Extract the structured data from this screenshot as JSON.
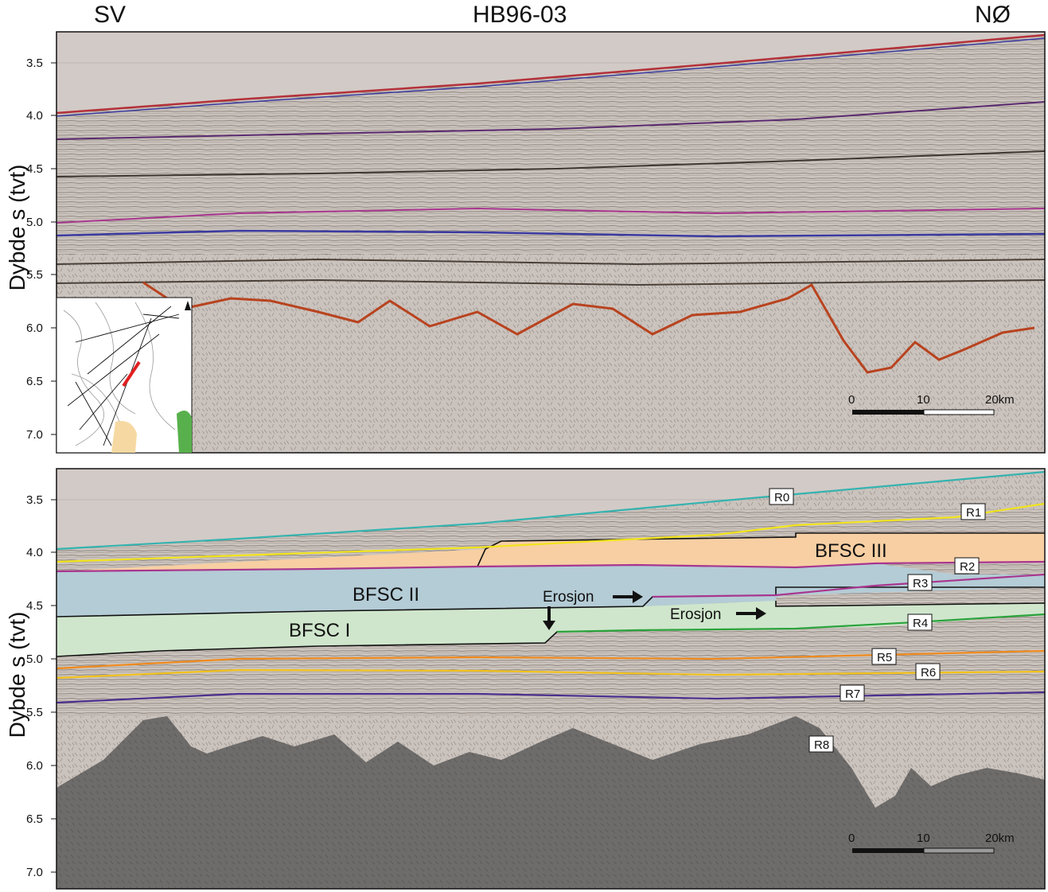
{
  "header": {
    "left": "SV",
    "title": "HB96-03",
    "right": "NØ"
  },
  "axis": {
    "label": "Dybde s (tvt)",
    "ticks": [
      "3.5",
      "4.0",
      "4.5",
      "5.0",
      "5.5",
      "6.0",
      "6.5",
      "7.0"
    ]
  },
  "scale_bar": {
    "labels": [
      "0",
      "10",
      "20km"
    ]
  },
  "units": {
    "bfsc3": "BFSC III",
    "bfsc2": "BFSC II",
    "bfsc1": "BFSC I"
  },
  "annotations": {
    "erosion_1": "Erosjon",
    "erosion_2": "Erosjon"
  },
  "reflectors": [
    "R0",
    "R1",
    "R2",
    "R3",
    "R4",
    "R5",
    "R6",
    "R7",
    "R8"
  ],
  "colors": {
    "bfsc3": "#f7cfa3",
    "bfsc2": "#b4ccd6",
    "bfsc1": "#cfe6cc",
    "R0": "#35b3b0",
    "R1": "#f2e41c",
    "R2": "#a8368f",
    "R3": "#a8368f",
    "R4": "#2aa33b",
    "R5": "#f08a1c",
    "R6": "#f2c21c",
    "R7": "#4b2f8f",
    "basement": "#6f6d6b",
    "water": "#d2cac6",
    "seismic": "#cbc3bd"
  }
}
